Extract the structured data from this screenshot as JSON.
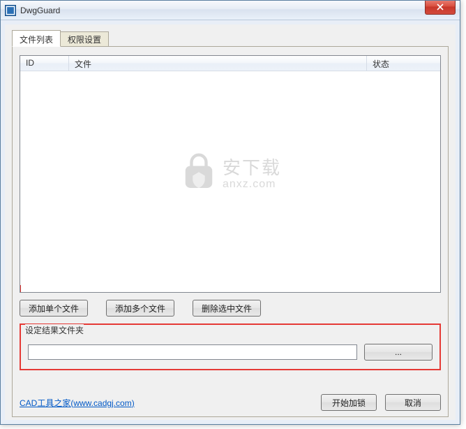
{
  "window": {
    "title": "DwgGuard"
  },
  "tabs": {
    "file_list": "文件列表",
    "permission": "权限设置"
  },
  "table": {
    "headers": {
      "id": "ID",
      "file": "文件",
      "status": "状态"
    }
  },
  "watermark": {
    "cn": "安下载",
    "url": "anxz.com"
  },
  "buttons": {
    "add_single": "添加单个文件",
    "add_multi": "添加多个文件",
    "delete_selected": "删除选中文件",
    "browse": "...",
    "start_lock": "开始加锁",
    "cancel": "取消"
  },
  "group": {
    "label": "设定结果文件夹",
    "path_value": ""
  },
  "footer_link": {
    "text": "CAD工具之家",
    "url_text": "www.cadgj.com"
  }
}
